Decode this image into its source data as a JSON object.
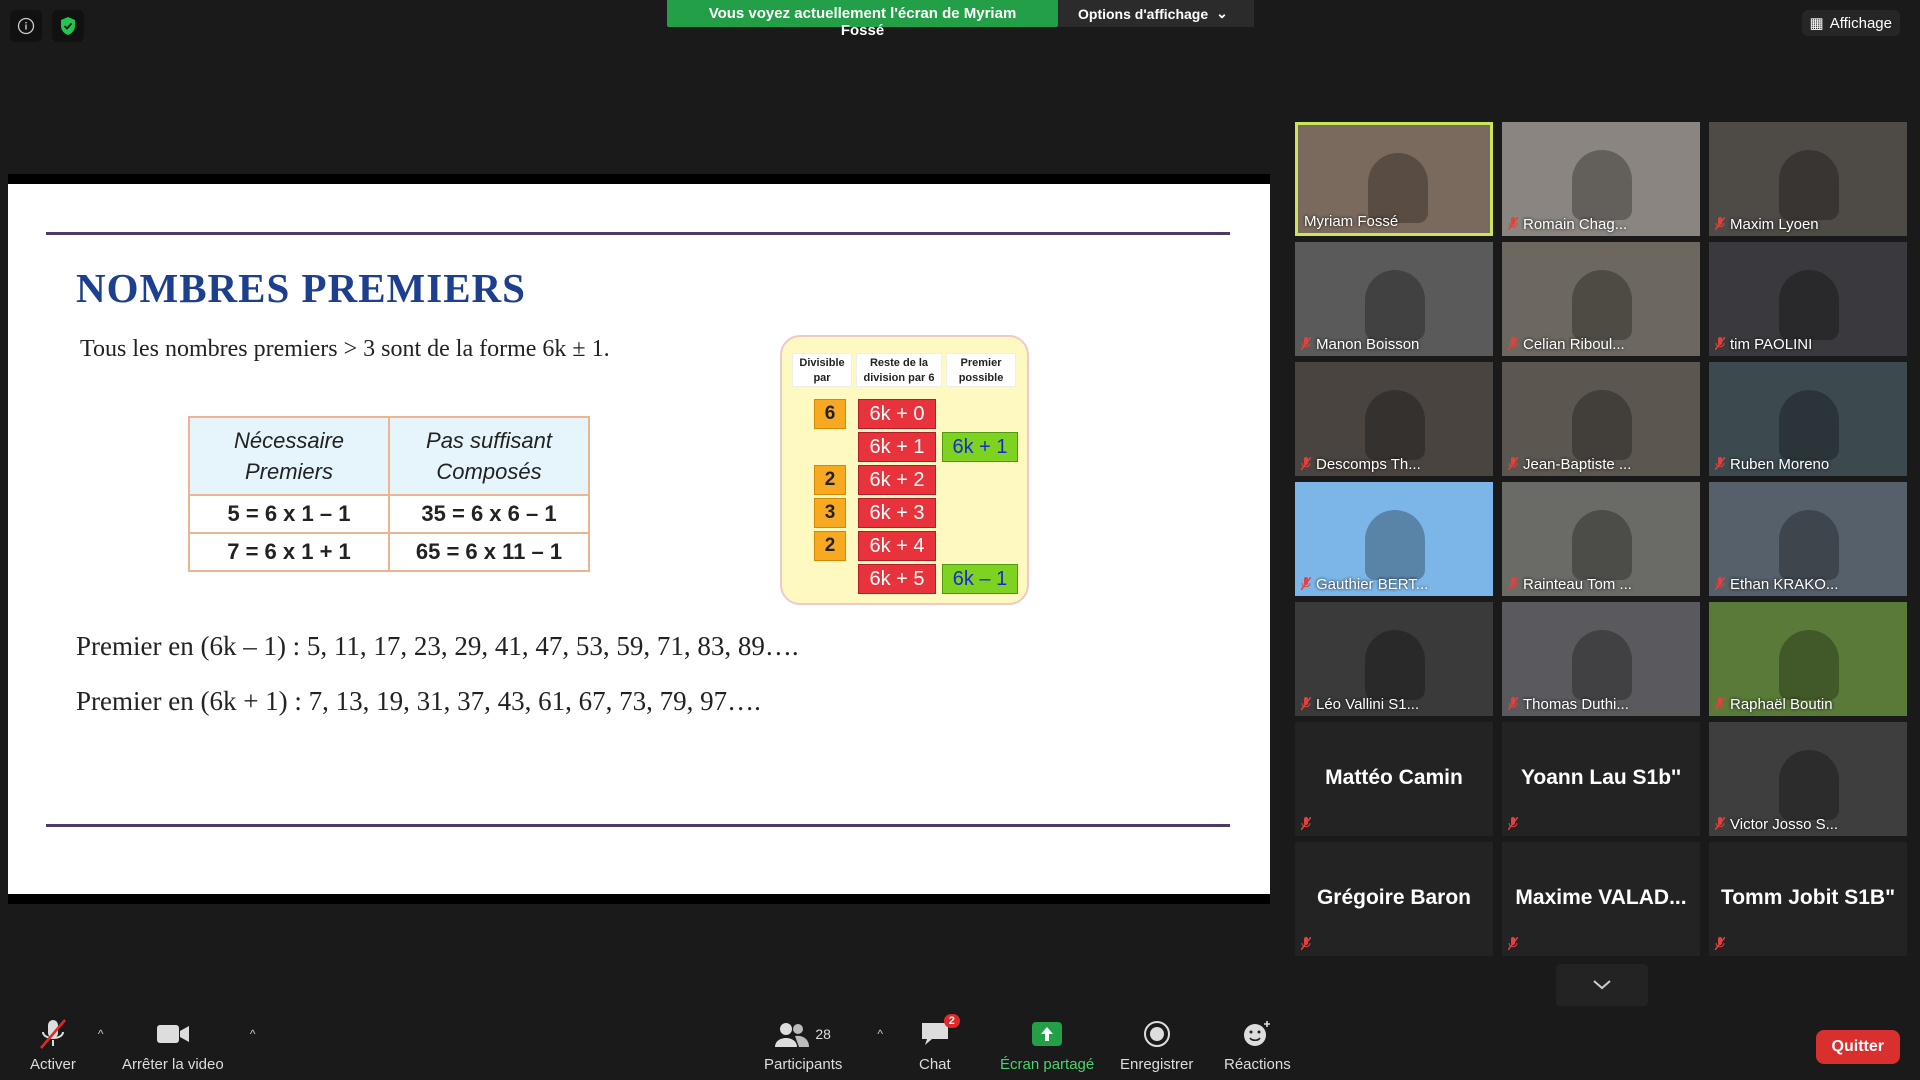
{
  "banner": {
    "text": "Vous voyez actuellement l'écran de Myriam Fossé",
    "options": "Options d'affichage"
  },
  "view_button": "Affichage",
  "slide": {
    "title": "NOMBRES PREMIERS",
    "subtitle": "Tous les nombres premiers  > 3 sont de la forme 6k ± 1.",
    "table": {
      "headers": [
        "Nécessaire\nPremiers",
        "Pas suffisant\nComposés"
      ],
      "rows": [
        [
          "5 = 6 x 1 – 1",
          "35 = 6 x  6 – 1"
        ],
        [
          "7 = 6 x 1 + 1",
          "65 = 6 x 11 – 1"
        ]
      ]
    },
    "card": {
      "headers": [
        "Divisible par",
        "Reste de la division par 6",
        "Premier possible"
      ],
      "divisors": [
        "6",
        "2",
        "3",
        "2"
      ],
      "remainders": [
        "6k + 0",
        "6k + 1",
        "6k + 2",
        "6k + 3",
        "6k + 4",
        "6k + 5"
      ],
      "possible": [
        "6k + 1",
        "6k – 1"
      ]
    },
    "line1": "Premier en (6k – 1) :  5, 11, 17, 23, 29, 41, 47, 53, 59, 71, 83, 89….",
    "line2": "Premier en (6k + 1) :  7, 13, 19, 31, 37, 43, 61, 67, 73, 79, 97…."
  },
  "participants": [
    "Myriam Fossé",
    "Romain Chag...",
    "Maxim Lyoen",
    "Manon Boisson",
    "Celian Riboul...",
    "tim PAOLINI",
    "Descomps Th...",
    "Jean-Baptiste ...",
    "Ruben Moreno",
    "Gauthier BERT...",
    "Rainteau Tom ...",
    "Ethan KRAKO...",
    "Léo Vallini S1...",
    "Thomas Duthi...",
    "Raphaël Boutin",
    "Mattéo Camin",
    "Yoann Lau S1b''",
    "Victor Josso S...",
    "Grégoire Baron",
    "Maxime  VALAD...",
    "Tomm Jobit S1B\""
  ],
  "toolbar": {
    "mute": "Activer",
    "video": "Arrêter la video",
    "participants": "Participants",
    "participants_count": "28",
    "chat": "Chat",
    "chat_badge": "2",
    "share": "Écran partagé",
    "record": "Enregistrer",
    "reactions": "Réactions",
    "quit": "Quitter"
  },
  "colors": {
    "share_green": "#23a047",
    "speaker_border": "#c9e55a",
    "quit_red": "#d92f2f"
  }
}
